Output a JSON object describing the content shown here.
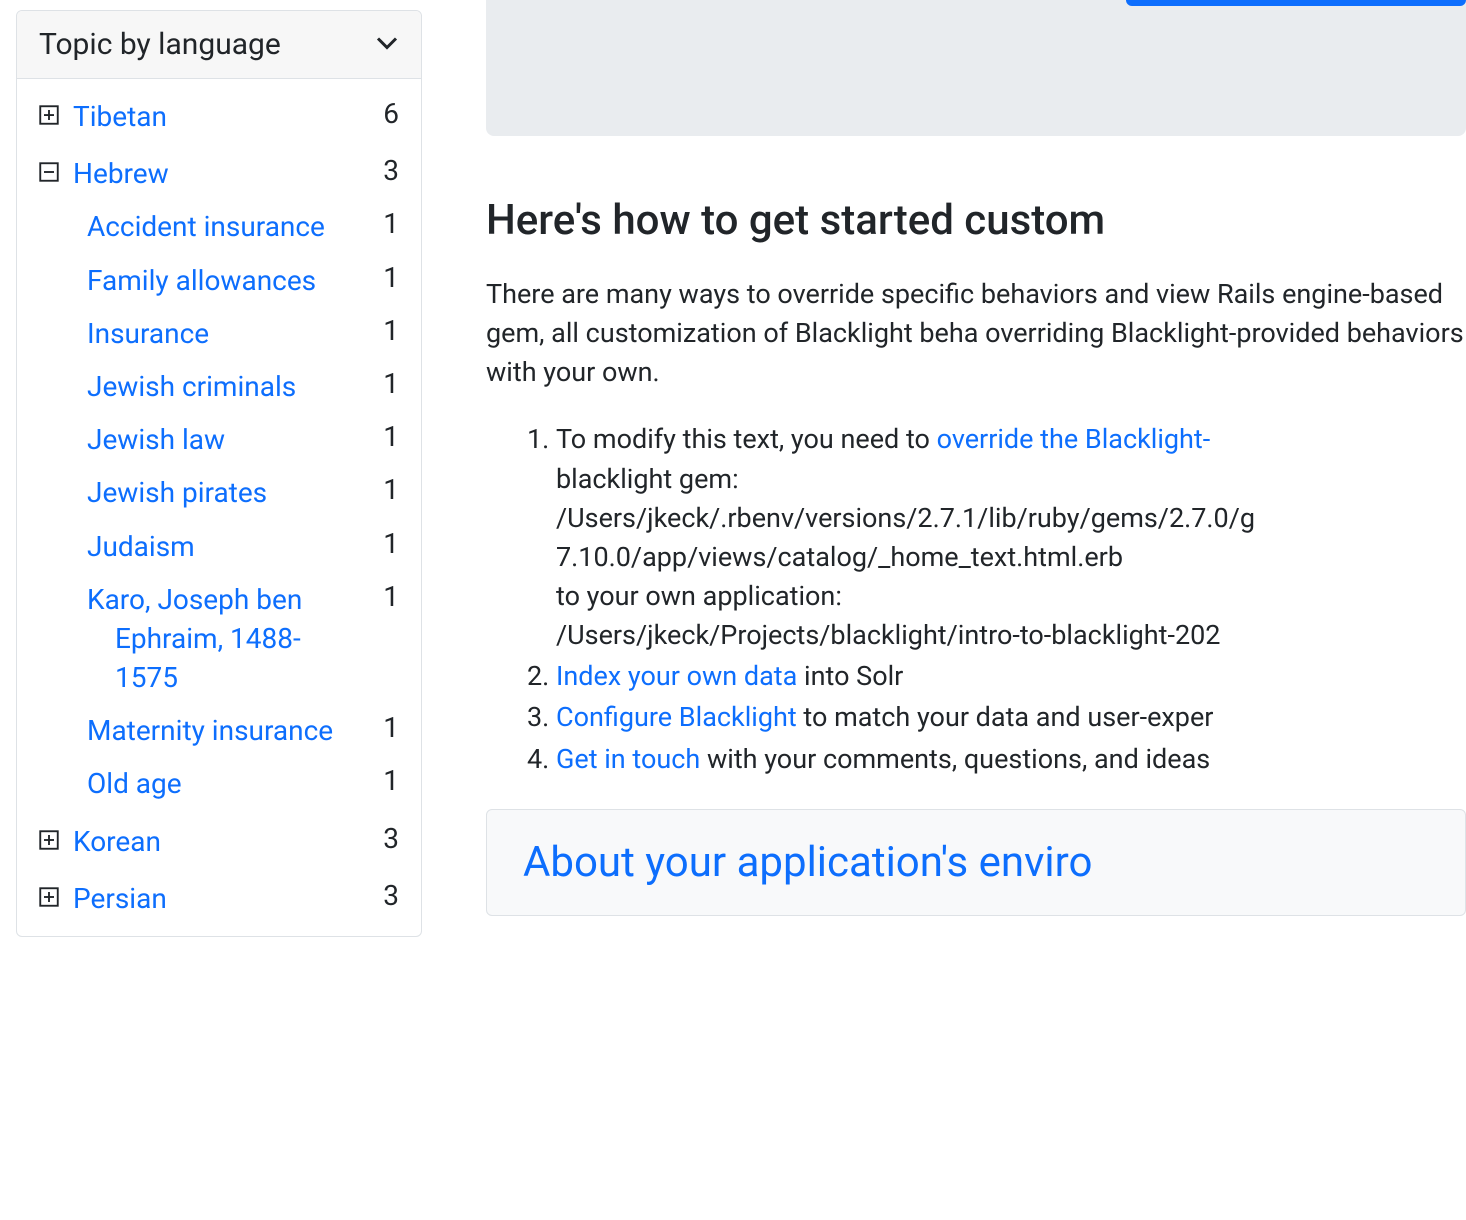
{
  "sidebar": {
    "facet_title": "Topic by language",
    "items": [
      {
        "label": "Tibetan",
        "count": "6",
        "expanded": false,
        "children": []
      },
      {
        "label": "Hebrew",
        "count": "3",
        "expanded": true,
        "children": [
          {
            "label": "Accident insurance",
            "count": "1"
          },
          {
            "label": "Family allowances",
            "count": "1"
          },
          {
            "label": "Insurance",
            "count": "1"
          },
          {
            "label": "Jewish criminals",
            "count": "1"
          },
          {
            "label": "Jewish law",
            "count": "1"
          },
          {
            "label": "Jewish pirates",
            "count": "1"
          },
          {
            "label": "Judaism",
            "count": "1"
          },
          {
            "label": "Karo, Joseph ben Ephraim, 1488-1575",
            "count": "1"
          },
          {
            "label": "Maternity insurance",
            "count": "1"
          },
          {
            "label": "Old age",
            "count": "1"
          }
        ]
      },
      {
        "label": "Korean",
        "count": "3",
        "expanded": false,
        "children": []
      },
      {
        "label": "Persian",
        "count": "3",
        "expanded": false,
        "children": []
      }
    ]
  },
  "main": {
    "heading": "Here's how to get started custom",
    "para": "There are many ways to override specific behaviors and view Rails engine-based gem, all customization of Blacklight beha overriding Blacklight-provided behaviors with your own.",
    "list": {
      "item1_pre": "To modify this text, you need to ",
      "item1_link": "override the Blacklight-",
      "item1_post1": "blacklight gem:",
      "item1_path1": "/Users/jkeck/.rbenv/versions/2.7.1/lib/ruby/gems/2.7.0/g",
      "item1_path2": "7.10.0/app/views/catalog/_home_text.html.erb",
      "item1_post2": "to your own application:",
      "item1_path3": "/Users/jkeck/Projects/blacklight/intro-to-blacklight-202",
      "item2_link": "Index your own data",
      "item2_post": " into Solr",
      "item3_link": "Configure Blacklight",
      "item3_post": " to match your data and user-exper",
      "item4_link": "Get in touch",
      "item4_post": " with your comments, questions, and ideas"
    },
    "env_link": "About your application's enviro"
  }
}
